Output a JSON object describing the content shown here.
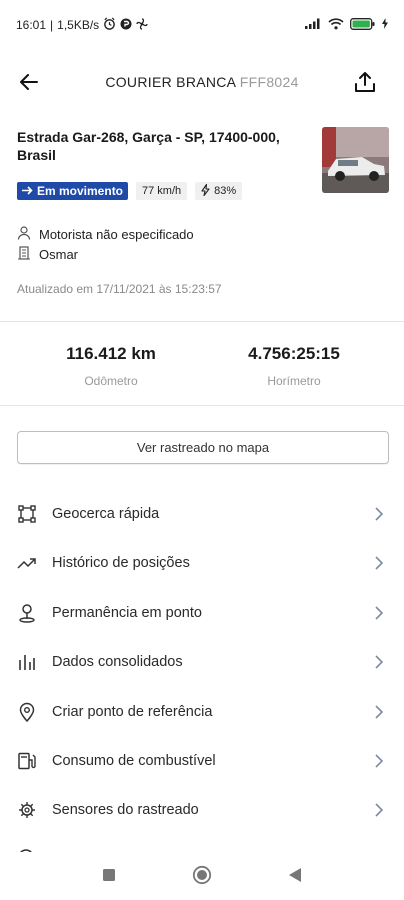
{
  "status_bar": {
    "time": "16:01",
    "net_speed": "1,5KB/s",
    "battery_icon": "battery-icon"
  },
  "header": {
    "title": "COURIER BRANCA",
    "plate": "FFF8024"
  },
  "vehicle": {
    "address": "Estrada Gar-268, Garça - SP, 17400-000, Brasil",
    "status_label": "Em movimento",
    "speed": "77 km/h",
    "battery_percent": "83%",
    "driver": "Motorista não especificado",
    "owner": "Osmar",
    "updated": "Atualizado em 17/11/2021 às 15:23:57",
    "status_color": "#1f4aa8"
  },
  "metrics": {
    "odometer_value": "116.412 km",
    "odometer_label": "Odômetro",
    "hourmeter_value": "4.756:25:15",
    "hourmeter_label": "Horímetro"
  },
  "actions": {
    "map_button": "Ver rastreado no mapa"
  },
  "menu": [
    {
      "label": "Geocerca rápida",
      "icon": "geofence-icon"
    },
    {
      "label": "Histórico de posições",
      "icon": "trend-icon"
    },
    {
      "label": "Permanência em ponto",
      "icon": "person-pin-icon"
    },
    {
      "label": "Dados consolidados",
      "icon": "bar-chart-icon"
    },
    {
      "label": "Criar ponto de referência",
      "icon": "location-pin-icon"
    },
    {
      "label": "Consumo de combustível",
      "icon": "fuel-icon"
    },
    {
      "label": "Sensores do rastreado",
      "icon": "sensor-icon"
    }
  ]
}
